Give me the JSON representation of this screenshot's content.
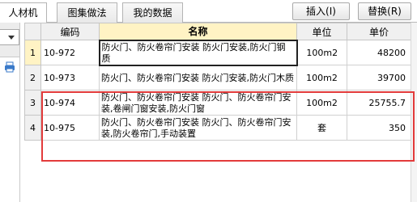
{
  "tabs": [
    {
      "label": "人材机"
    },
    {
      "label": "图集做法"
    },
    {
      "label": "我的数据"
    }
  ],
  "toolbar": {
    "insert_label": "插入(I)",
    "replace_label": "替换(R)"
  },
  "left_panel": {
    "icons": [
      "dropdown-arrow-icon",
      "print-icon"
    ]
  },
  "table": {
    "columns": [
      "编码",
      "名称",
      "单位",
      "单价"
    ],
    "rows": [
      {
        "num": "1",
        "code": "10-972",
        "name": "防火门、防火卷帘门安装 防火门安装,防火门钢质",
        "unit": "100m2",
        "price": "48200"
      },
      {
        "num": "2",
        "code": "10-973",
        "name": "防火门、防火卷帘门安装 防火门安装,防火门木质",
        "unit": "100m2",
        "price": "39700"
      },
      {
        "num": "3",
        "code": "10-974",
        "name": "防火门、防火卷帘门安装 防火门、防火卷帘门安装,卷闸门窗安装,防火门窗",
        "unit": "100m2",
        "price": "25755.7"
      },
      {
        "num": "4",
        "code": "10-975",
        "name": "防火门、防火卷帘门安装 防火门、防火卷帘门安装,防火卷帘门,手动装置",
        "unit": "套",
        "price": "350"
      }
    ]
  },
  "colors": {
    "highlight": "#e33b3b",
    "header_highlight": "#fff3c4",
    "icon_blue": "#3a7ac9"
  }
}
